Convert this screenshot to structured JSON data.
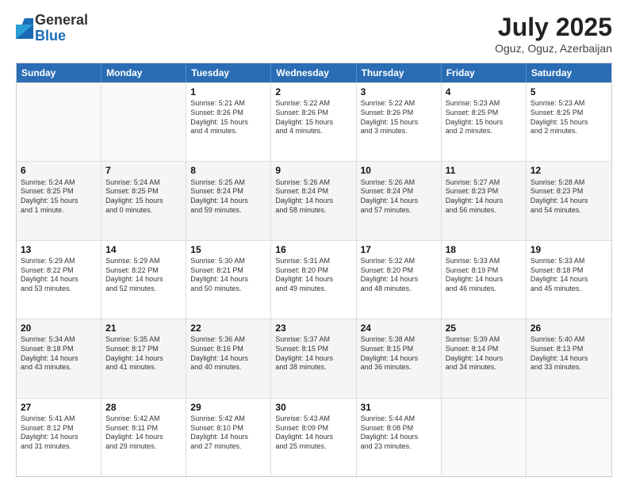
{
  "logo": {
    "general": "General",
    "blue": "Blue"
  },
  "title": "July 2025",
  "subtitle": "Oguz, Oguz, Azerbaijan",
  "header_days": [
    "Sunday",
    "Monday",
    "Tuesday",
    "Wednesday",
    "Thursday",
    "Friday",
    "Saturday"
  ],
  "weeks": [
    [
      {
        "day": "",
        "empty": true
      },
      {
        "day": "",
        "empty": true
      },
      {
        "day": "1",
        "lines": [
          "Sunrise: 5:21 AM",
          "Sunset: 8:26 PM",
          "Daylight: 15 hours",
          "and 4 minutes."
        ]
      },
      {
        "day": "2",
        "lines": [
          "Sunrise: 5:22 AM",
          "Sunset: 8:26 PM",
          "Daylight: 15 hours",
          "and 4 minutes."
        ]
      },
      {
        "day": "3",
        "lines": [
          "Sunrise: 5:22 AM",
          "Sunset: 8:26 PM",
          "Daylight: 15 hours",
          "and 3 minutes."
        ]
      },
      {
        "day": "4",
        "lines": [
          "Sunrise: 5:23 AM",
          "Sunset: 8:25 PM",
          "Daylight: 15 hours",
          "and 2 minutes."
        ]
      },
      {
        "day": "5",
        "lines": [
          "Sunrise: 5:23 AM",
          "Sunset: 8:25 PM",
          "Daylight: 15 hours",
          "and 2 minutes."
        ]
      }
    ],
    [
      {
        "day": "6",
        "lines": [
          "Sunrise: 5:24 AM",
          "Sunset: 8:25 PM",
          "Daylight: 15 hours",
          "and 1 minute."
        ]
      },
      {
        "day": "7",
        "lines": [
          "Sunrise: 5:24 AM",
          "Sunset: 8:25 PM",
          "Daylight: 15 hours",
          "and 0 minutes."
        ]
      },
      {
        "day": "8",
        "lines": [
          "Sunrise: 5:25 AM",
          "Sunset: 8:24 PM",
          "Daylight: 14 hours",
          "and 59 minutes."
        ]
      },
      {
        "day": "9",
        "lines": [
          "Sunrise: 5:26 AM",
          "Sunset: 8:24 PM",
          "Daylight: 14 hours",
          "and 58 minutes."
        ]
      },
      {
        "day": "10",
        "lines": [
          "Sunrise: 5:26 AM",
          "Sunset: 8:24 PM",
          "Daylight: 14 hours",
          "and 57 minutes."
        ]
      },
      {
        "day": "11",
        "lines": [
          "Sunrise: 5:27 AM",
          "Sunset: 8:23 PM",
          "Daylight: 14 hours",
          "and 56 minutes."
        ]
      },
      {
        "day": "12",
        "lines": [
          "Sunrise: 5:28 AM",
          "Sunset: 8:23 PM",
          "Daylight: 14 hours",
          "and 54 minutes."
        ]
      }
    ],
    [
      {
        "day": "13",
        "lines": [
          "Sunrise: 5:29 AM",
          "Sunset: 8:22 PM",
          "Daylight: 14 hours",
          "and 53 minutes."
        ]
      },
      {
        "day": "14",
        "lines": [
          "Sunrise: 5:29 AM",
          "Sunset: 8:22 PM",
          "Daylight: 14 hours",
          "and 52 minutes."
        ]
      },
      {
        "day": "15",
        "lines": [
          "Sunrise: 5:30 AM",
          "Sunset: 8:21 PM",
          "Daylight: 14 hours",
          "and 50 minutes."
        ]
      },
      {
        "day": "16",
        "lines": [
          "Sunrise: 5:31 AM",
          "Sunset: 8:20 PM",
          "Daylight: 14 hours",
          "and 49 minutes."
        ]
      },
      {
        "day": "17",
        "lines": [
          "Sunrise: 5:32 AM",
          "Sunset: 8:20 PM",
          "Daylight: 14 hours",
          "and 48 minutes."
        ]
      },
      {
        "day": "18",
        "lines": [
          "Sunrise: 5:33 AM",
          "Sunset: 8:19 PM",
          "Daylight: 14 hours",
          "and 46 minutes."
        ]
      },
      {
        "day": "19",
        "lines": [
          "Sunrise: 5:33 AM",
          "Sunset: 8:18 PM",
          "Daylight: 14 hours",
          "and 45 minutes."
        ]
      }
    ],
    [
      {
        "day": "20",
        "lines": [
          "Sunrise: 5:34 AM",
          "Sunset: 8:18 PM",
          "Daylight: 14 hours",
          "and 43 minutes."
        ]
      },
      {
        "day": "21",
        "lines": [
          "Sunrise: 5:35 AM",
          "Sunset: 8:17 PM",
          "Daylight: 14 hours",
          "and 41 minutes."
        ]
      },
      {
        "day": "22",
        "lines": [
          "Sunrise: 5:36 AM",
          "Sunset: 8:16 PM",
          "Daylight: 14 hours",
          "and 40 minutes."
        ]
      },
      {
        "day": "23",
        "lines": [
          "Sunrise: 5:37 AM",
          "Sunset: 8:15 PM",
          "Daylight: 14 hours",
          "and 38 minutes."
        ]
      },
      {
        "day": "24",
        "lines": [
          "Sunrise: 5:38 AM",
          "Sunset: 8:15 PM",
          "Daylight: 14 hours",
          "and 36 minutes."
        ]
      },
      {
        "day": "25",
        "lines": [
          "Sunrise: 5:39 AM",
          "Sunset: 8:14 PM",
          "Daylight: 14 hours",
          "and 34 minutes."
        ]
      },
      {
        "day": "26",
        "lines": [
          "Sunrise: 5:40 AM",
          "Sunset: 8:13 PM",
          "Daylight: 14 hours",
          "and 33 minutes."
        ]
      }
    ],
    [
      {
        "day": "27",
        "lines": [
          "Sunrise: 5:41 AM",
          "Sunset: 8:12 PM",
          "Daylight: 14 hours",
          "and 31 minutes."
        ]
      },
      {
        "day": "28",
        "lines": [
          "Sunrise: 5:42 AM",
          "Sunset: 8:11 PM",
          "Daylight: 14 hours",
          "and 29 minutes."
        ]
      },
      {
        "day": "29",
        "lines": [
          "Sunrise: 5:42 AM",
          "Sunset: 8:10 PM",
          "Daylight: 14 hours",
          "and 27 minutes."
        ]
      },
      {
        "day": "30",
        "lines": [
          "Sunrise: 5:43 AM",
          "Sunset: 8:09 PM",
          "Daylight: 14 hours",
          "and 25 minutes."
        ]
      },
      {
        "day": "31",
        "lines": [
          "Sunrise: 5:44 AM",
          "Sunset: 8:08 PM",
          "Daylight: 14 hours",
          "and 23 minutes."
        ]
      },
      {
        "day": "",
        "empty": true
      },
      {
        "day": "",
        "empty": true
      }
    ]
  ]
}
